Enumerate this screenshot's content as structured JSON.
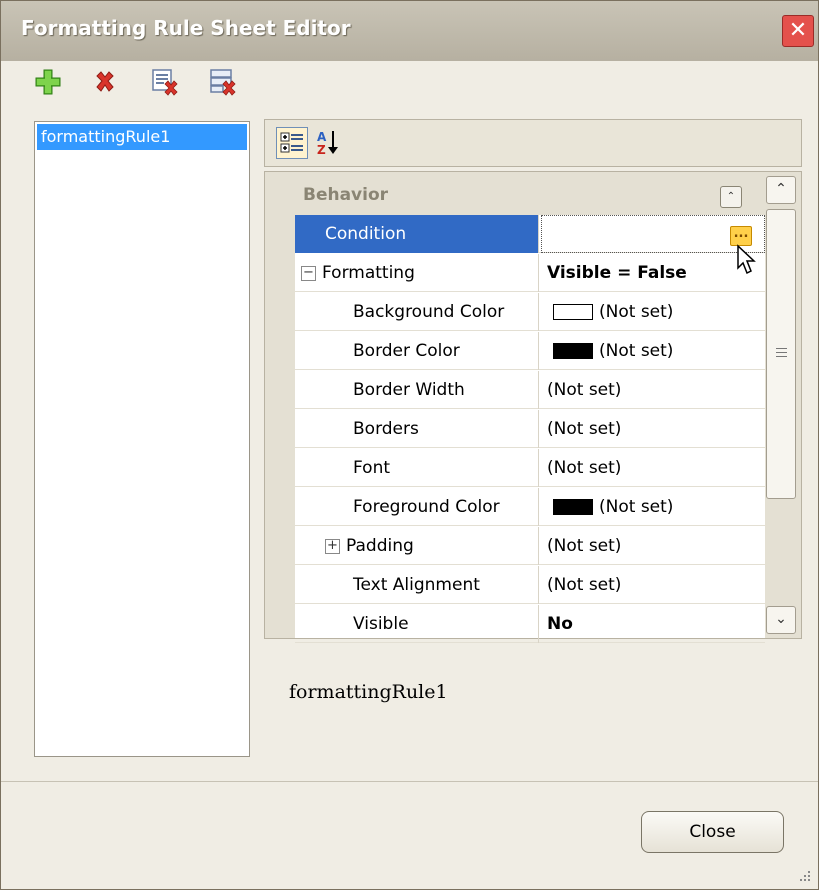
{
  "window": {
    "title": "Formatting Rule Sheet Editor"
  },
  "toolbar": {
    "items": [
      {
        "icon": "plus-icon",
        "label": "Add"
      },
      {
        "icon": "delete-icon",
        "label": "Delete"
      },
      {
        "icon": "delete-sheet-icon",
        "label": "Remove"
      },
      {
        "icon": "purge-sheet-icon",
        "label": "Purge"
      }
    ]
  },
  "rules": {
    "items": [
      "formattingRule1"
    ]
  },
  "property_grid": {
    "toolbar": {
      "categorized_icon": "categorized-icon",
      "alphabetical_icon": "sort-az-icon"
    },
    "category": "Behavior",
    "rows": [
      {
        "name": "Condition",
        "value": "",
        "selected": true
      },
      {
        "name": "Formatting",
        "value": "Visible = False",
        "expander": "−",
        "bold_value": true
      },
      {
        "name": "Background Color",
        "value": "(Not set)",
        "swatch": "#ffffff"
      },
      {
        "name": "Border Color",
        "value": "(Not set)",
        "swatch": "#000000"
      },
      {
        "name": "Border Width",
        "value": "(Not set)"
      },
      {
        "name": "Borders",
        "value": "(Not set)"
      },
      {
        "name": "Font",
        "value": "(Not set)"
      },
      {
        "name": "Foreground Color",
        "value": "(Not set)",
        "swatch": "#000000"
      },
      {
        "name": "Padding",
        "value": "(Not set)",
        "expander": "+"
      },
      {
        "name": "Text Alignment",
        "value": "(Not set)"
      },
      {
        "name": "Visible",
        "value": "No",
        "bold_value": true
      }
    ],
    "ellipsis_label": "...",
    "collapse_glyph": "⌃",
    "scroll_up": "⌃",
    "scroll_down": "⌄"
  },
  "caption": "formattingRule1",
  "footer": {
    "close_label": "Close"
  },
  "colors": {
    "selection": "#316ac5",
    "list_selection": "#3399ff",
    "title_bg": "#bcb6a7",
    "close_red": "#e4514c"
  }
}
